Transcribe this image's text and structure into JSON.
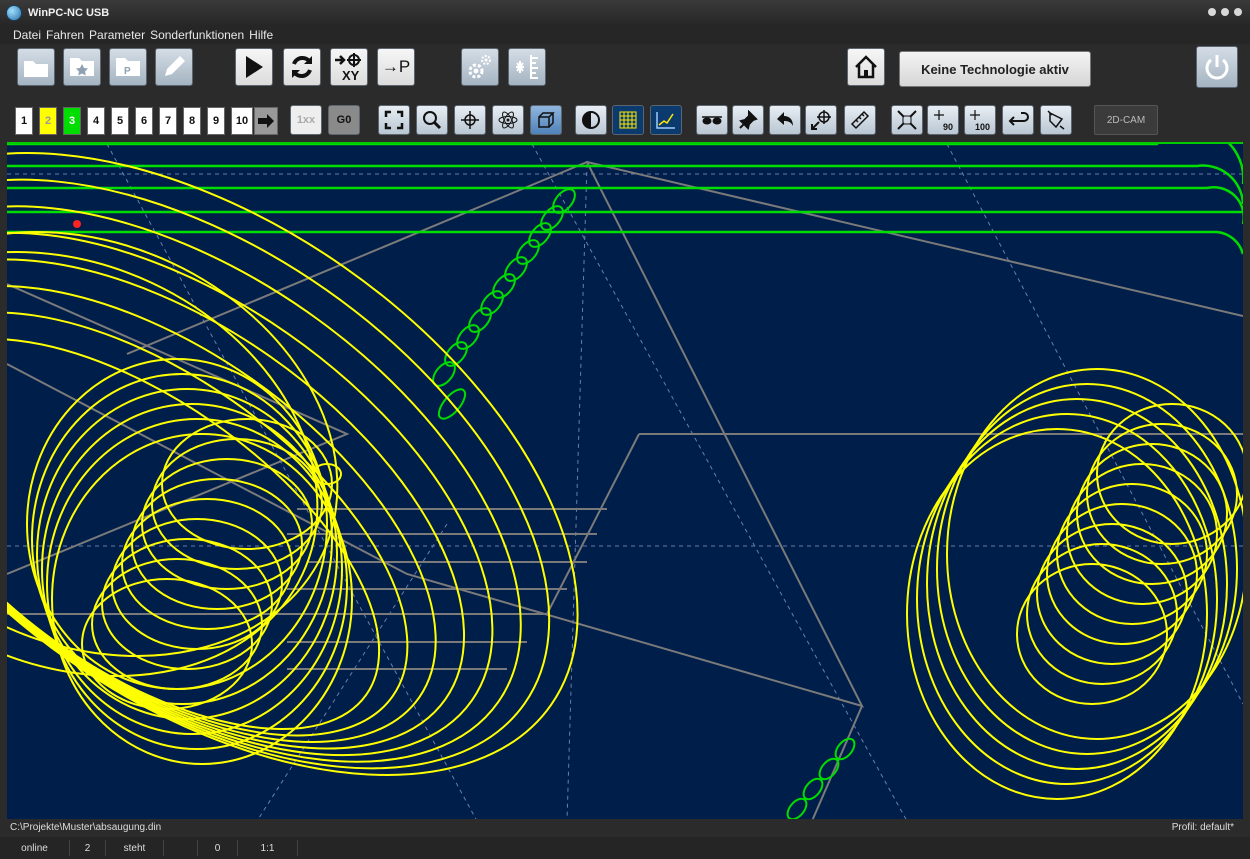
{
  "window": {
    "title": "WinPC-NC USB"
  },
  "menu": [
    "Datei",
    "Fahren",
    "Parameter",
    "Sonderfunktionen",
    "Hilfe"
  ],
  "toolbar": {
    "technology_label": "Keine Technologie aktiv",
    "move_to_p_label": "→P",
    "xy_label": "XY",
    "icons": [
      "folder-icon",
      "favorites-folder-icon",
      "parameter-folder-icon",
      "edit-pencil-icon",
      "play-icon",
      "repeat-icon",
      "move-to-xy-icon",
      "move-to-p-icon",
      "settings-gears-icon",
      "manual-move-icon",
      "home-icon",
      "power-icon"
    ]
  },
  "toolbar2": {
    "numbers": [
      "1",
      "2",
      "3",
      "4",
      "5",
      "6",
      "7",
      "8",
      "9",
      "10"
    ],
    "number_colors": {
      "2": "#ffff00",
      "3": "#00dd00"
    },
    "btn_1xx": "1xx",
    "btn_g0": "G0",
    "btn_90": "90",
    "btn_100": "100",
    "btn_2dcam": "2D-CAM",
    "view_icons": [
      "fit-view-icon",
      "zoom-icon",
      "pan-icon",
      "atom-icon",
      "3d-box-icon",
      "contrast-icon",
      "grid-icon",
      "graph-icon",
      "glasses-icon",
      "pin-icon",
      "back-arrow-icon",
      "target-icon",
      "ruler-icon",
      "shrink-icon",
      "rotate-90-icon",
      "scale-100-icon",
      "return-icon",
      "transform-icon"
    ]
  },
  "colors": {
    "canvas_bg": "#001e4a",
    "path_yellow": "#ffff00",
    "path_green": "#00dd00",
    "frame_grey": "#7a7a7a"
  },
  "status": {
    "file_path": "C:\\Projekte\\Muster\\absaugung.din",
    "profile": "Profil: default*",
    "state_online": "online",
    "cell_2": "2",
    "state_motion": "steht",
    "cell_0": "0",
    "scale": "1:1"
  }
}
